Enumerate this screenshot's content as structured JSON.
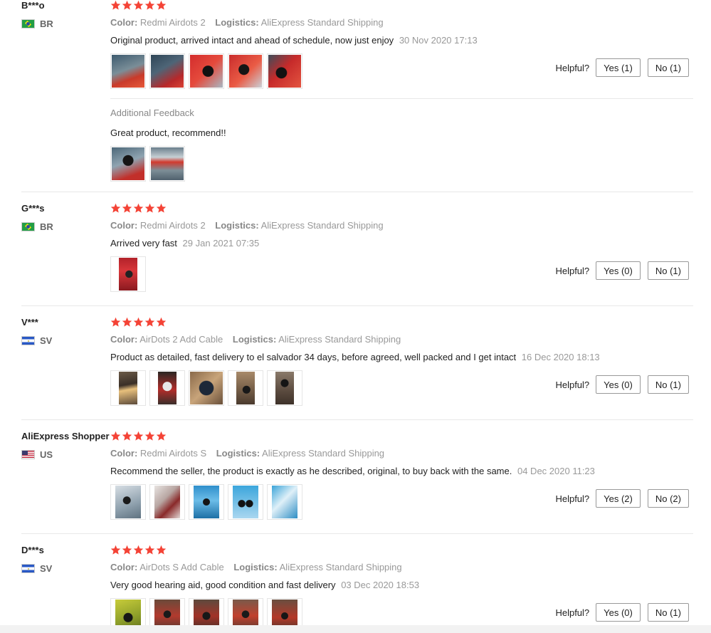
{
  "colors": {
    "star": "#f44336",
    "text": "#222222",
    "muted": "#999999",
    "divider": "#e8e8e8"
  },
  "labels": {
    "color_key": "Color:",
    "logistics_key": "Logistics:",
    "helpful": "Helpful?",
    "additional_feedback": "Additional Feedback"
  },
  "reviews": [
    {
      "user": "B***o",
      "country": "BR",
      "rating": 5,
      "color": "Redmi Airdots 2",
      "logistics": "AliExpress Standard Shipping",
      "text": "Original product, arrived intact and ahead of schedule, now just enjoy",
      "date": "30 Nov 2020 17:13",
      "photos": 5,
      "yes_label": "Yes (1)",
      "no_label": "No (1)",
      "additional": {
        "text": "Great product, recommend!!",
        "photos": 2
      }
    },
    {
      "user": "G***s",
      "country": "BR",
      "rating": 5,
      "color": "Redmi Airdots 2",
      "logistics": "AliExpress Standard Shipping",
      "text": "Arrived very fast",
      "date": "29 Jan 2021 07:35",
      "photos": 1,
      "yes_label": "Yes (0)",
      "no_label": "No (1)"
    },
    {
      "user": "V***",
      "country": "SV",
      "rating": 5,
      "color": "AirDots 2 Add Cable",
      "logistics": "AliExpress Standard Shipping",
      "text": "Product as detailed, fast delivery to el salvador 34 days, before agreed, well packed and I get intact",
      "date": "16 Dec 2020 18:13",
      "photos": 5,
      "yes_label": "Yes (0)",
      "no_label": "No (1)"
    },
    {
      "user": "AliExpress Shopper",
      "country": "US",
      "rating": 5,
      "color": "Redmi Airdots S",
      "logistics": "AliExpress Standard Shipping",
      "text": "Recommend the seller, the product is exactly as he described, original, to buy back with the same.",
      "date": "04 Dec 2020 11:23",
      "photos": 5,
      "yes_label": "Yes (2)",
      "no_label": "No (2)"
    },
    {
      "user": "D***s",
      "country": "SV",
      "rating": 5,
      "color": "AirDots S Add Cable",
      "logistics": "AliExpress Standard Shipping",
      "text": "Very good hearing aid, good condition and fast delivery",
      "date": "03 Dec 2020 18:53",
      "photos": 5,
      "yes_label": "Yes (0)",
      "no_label": "No (1)"
    }
  ]
}
